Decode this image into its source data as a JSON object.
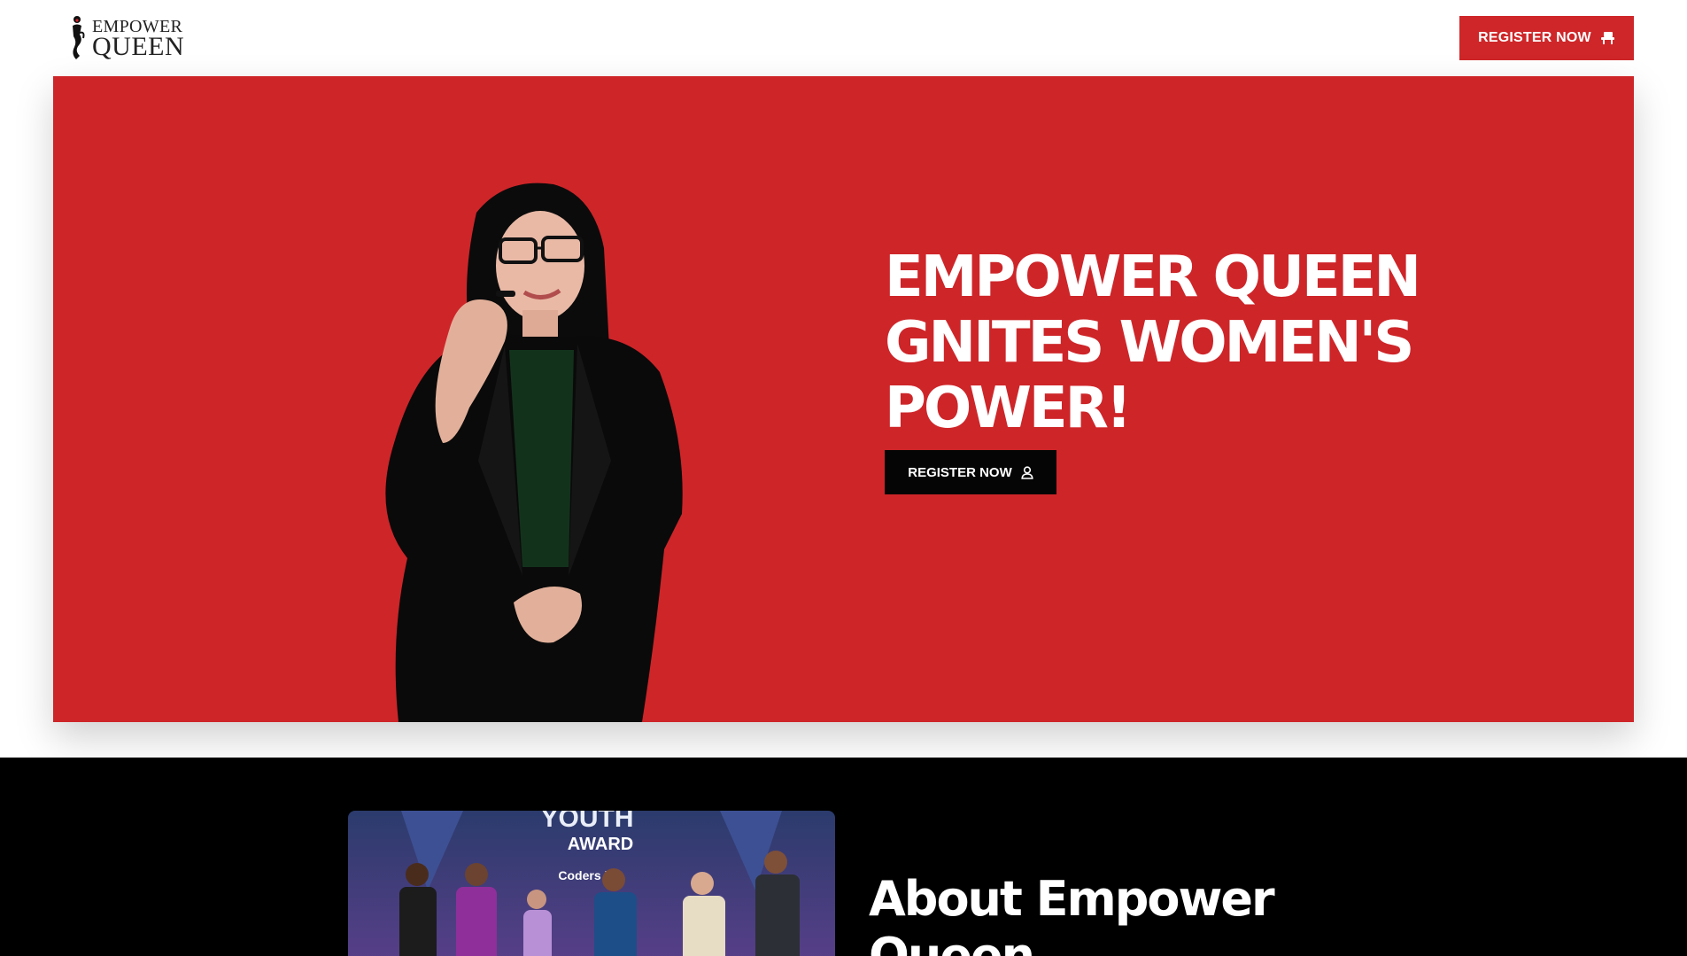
{
  "header": {
    "logo_line1": "EMPOWER",
    "logo_line2": "QUEEN",
    "register_label": "REGISTER NOW"
  },
  "hero": {
    "title": "EMPOWER QUEEN GNITES WOMEN'S POWER!",
    "register_label": "REGISTER NOW"
  },
  "about": {
    "title": "About Empower Queen",
    "photo_banner_line1": "YOUTH",
    "photo_banner_line2": "AWARD",
    "photo_sponsor": "Coders bd"
  },
  "colors": {
    "brand_red": "#ce2529",
    "button_black": "#050505",
    "about_bg": "#000000"
  },
  "icons": {
    "header_button_icon": "chair-icon",
    "hero_button_icon": "user-icon"
  }
}
